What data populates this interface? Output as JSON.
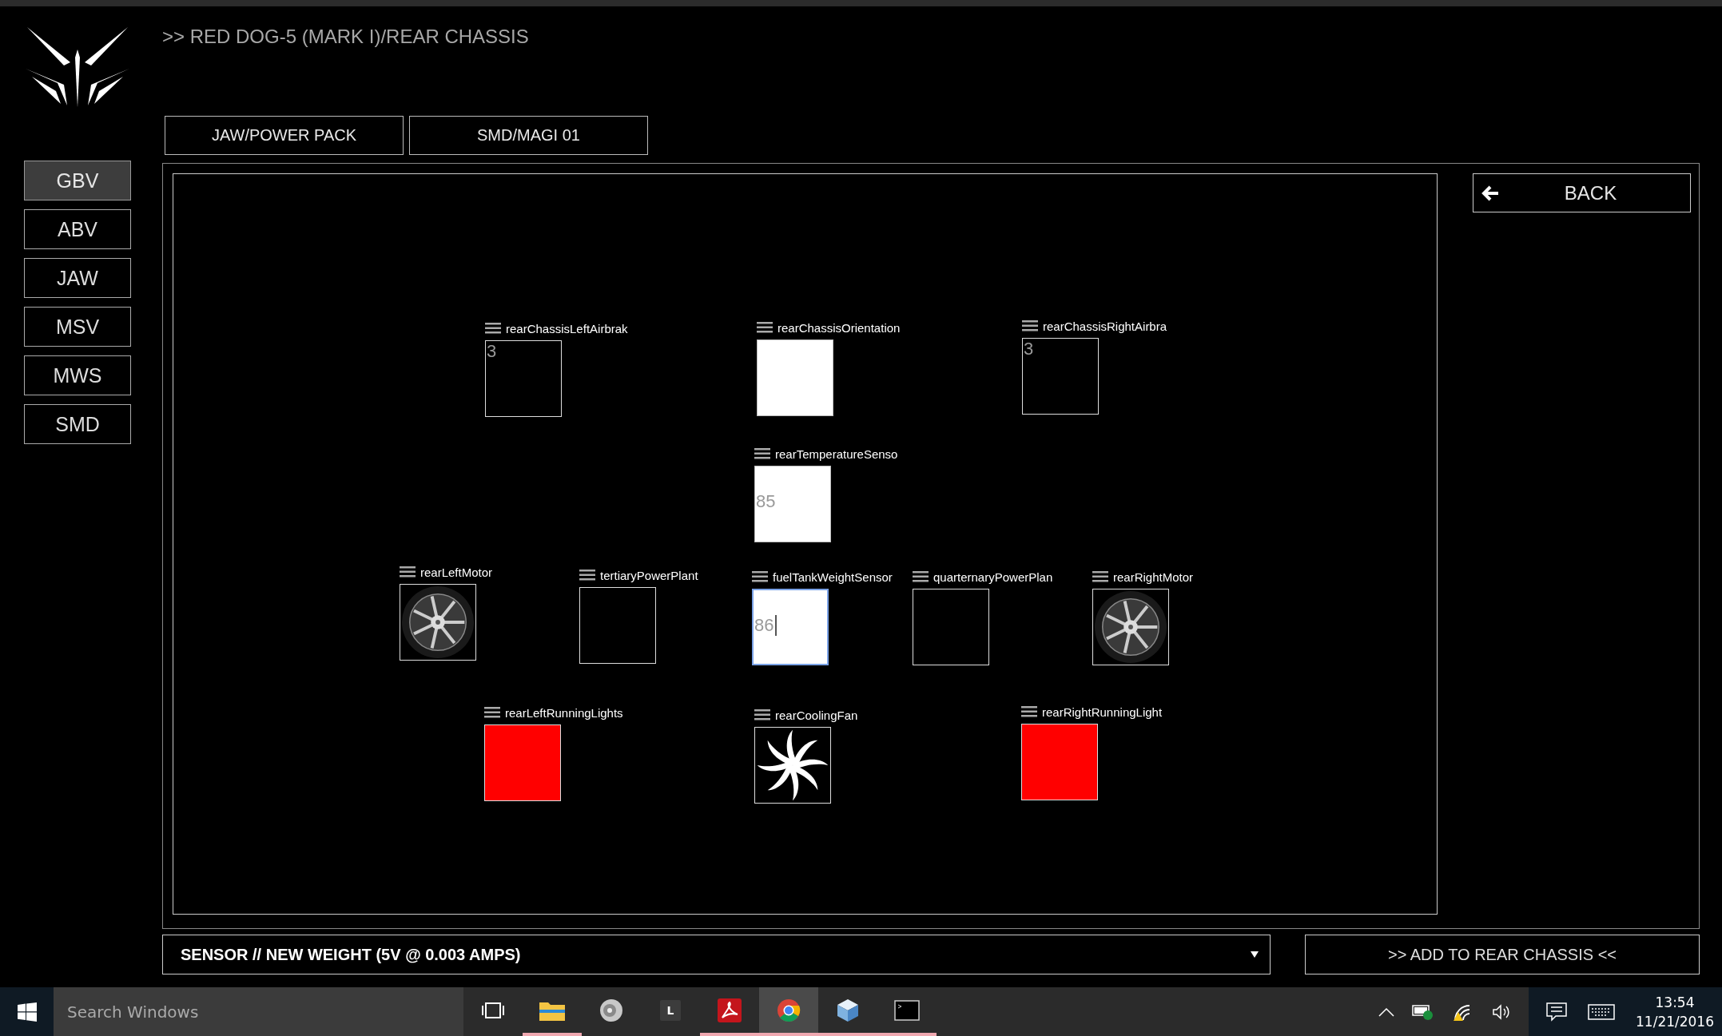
{
  "breadcrumb": ">> RED DOG-5 (MARK I)/REAR CHASSIS",
  "tabs": [
    "JAW/POWER PACK",
    "SMD/MAGI 01"
  ],
  "sidebar": {
    "items": [
      {
        "label": "GBV",
        "selected": true
      },
      {
        "label": "ABV",
        "selected": false
      },
      {
        "label": "JAW",
        "selected": false
      },
      {
        "label": "MSV",
        "selected": false
      },
      {
        "label": "MWS",
        "selected": false
      },
      {
        "label": "SMD",
        "selected": false
      }
    ]
  },
  "back_button": "BACK",
  "nodes": [
    {
      "label": "rearChassisLeftAirbrak",
      "kind": "dark-field",
      "value": "3",
      "focused": false
    },
    {
      "label": "rearChassisOrientation",
      "kind": "light-field",
      "focused": false
    },
    {
      "label": "rearChassisRightAirbra",
      "kind": "dark-field",
      "value": "3",
      "focused": false
    },
    {
      "label": "rearTemperatureSenso",
      "kind": "light-field",
      "value": "85",
      "focused": false
    },
    {
      "label": "rearLeftMotor",
      "kind": "wheel",
      "focused": false
    },
    {
      "label": "tertiaryPowerPlant",
      "kind": "dark-field",
      "focused": false
    },
    {
      "label": "fuelTankWeightSensor",
      "kind": "light-field",
      "value": "86",
      "focused": true
    },
    {
      "label": "quarternaryPowerPlan",
      "kind": "dark-field",
      "focused": false
    },
    {
      "label": "rearRightMotor",
      "kind": "wheel",
      "focused": false
    },
    {
      "label": "rearLeftRunningLights",
      "kind": "swatch",
      "color": "#ff0000",
      "focused": false
    },
    {
      "label": "rearCoolingFan",
      "kind": "fan",
      "focused": false
    },
    {
      "label": "rearRightRunningLight",
      "kind": "swatch",
      "color": "#ff0000",
      "focused": false
    }
  ],
  "component_select": {
    "value": "SENSOR // NEW WEIGHT (5V @ 0.003 AMPS)"
  },
  "add_button": ">> ADD TO REAR CHASSIS <<",
  "taskbar": {
    "search": {
      "placeholder": "Search Windows"
    },
    "apps": [
      {
        "kind": "task-view",
        "running": false,
        "active": false
      },
      {
        "kind": "folder",
        "running": true,
        "active": false
      },
      {
        "kind": "speaker",
        "running": false,
        "active": false
      },
      {
        "kind": "letter",
        "letter": "L",
        "running": false,
        "active": false
      },
      {
        "kind": "pdf",
        "running": true,
        "active": false
      },
      {
        "kind": "browser",
        "running": true,
        "active": true
      },
      {
        "kind": "cube",
        "running": true,
        "active": false
      },
      {
        "kind": "terminal",
        "running": true,
        "active": false
      }
    ],
    "time": "13:54",
    "date": "11/21/2016"
  }
}
